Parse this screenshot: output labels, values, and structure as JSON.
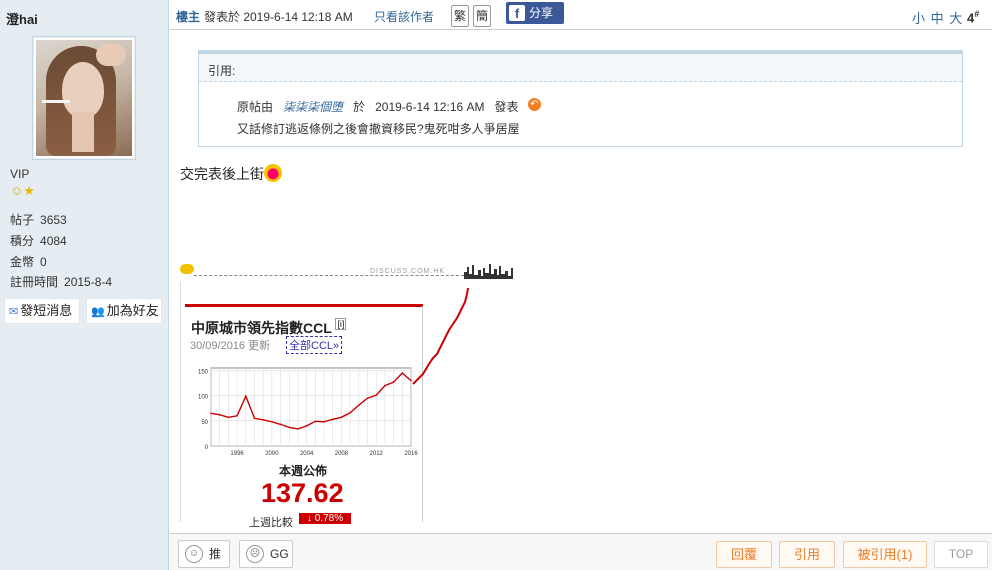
{
  "author": {
    "username": "澄hai",
    "group": "VIP",
    "stats": [
      {
        "label": "帖子",
        "value": "3653"
      },
      {
        "label": "積分",
        "value": "4084"
      },
      {
        "label": "金幣",
        "value": "0"
      },
      {
        "label": "註冊時間",
        "value": "2015-8-4"
      }
    ],
    "send_message": "發短消息",
    "add_friend": "加為好友"
  },
  "header": {
    "owner_label": "樓主",
    "posted_at": "發表於 2019-6-14 12:18 AM",
    "only_author": "只看該作者",
    "trad_btn": "繁",
    "simp_btn": "簡",
    "share_label": "分享",
    "font_sizes": "小 中 大",
    "floor_number": "4",
    "floor_suffix": "#"
  },
  "quote": {
    "header": "引用:",
    "prefix": "原帖由",
    "quoted_author": "柒柒柒個堕",
    "at_word": "於",
    "quoted_time": "2019-6-14  12:16  AM",
    "posted_word": "發表",
    "quoted_text": "又話修訂逃返條例之後會撤資移民?鬼死咁多人爭居屋"
  },
  "post": {
    "text": "交完表後上街"
  },
  "signature": {
    "watermark": "DISCUSS.COM.HK",
    "card": {
      "title": "中原城市領先指數CCL",
      "info_badge": "[i]",
      "updated": "30/09/2016 更新",
      "link": "全部CCL»",
      "weekly_label": "本週公佈",
      "value": "137.62",
      "last_week_label": "上週比較",
      "change": "↓ 0.78%"
    }
  },
  "chart_data": {
    "type": "line",
    "x": [
      1993,
      1994,
      1995,
      1996,
      1997,
      1998,
      1999,
      2000,
      2001,
      2002,
      2003,
      2004,
      2005,
      2006,
      2007,
      2008,
      2009,
      2010,
      2011,
      2012,
      2013,
      2014,
      2015,
      2016
    ],
    "y": [
      65,
      62,
      57,
      60,
      99,
      55,
      52,
      48,
      43,
      37,
      34,
      40,
      49,
      48,
      53,
      57,
      66,
      81,
      95,
      101,
      120,
      127,
      145,
      130
    ],
    "xticks": [
      "1996",
      "2000",
      "2004",
      "2008",
      "2012",
      "2016"
    ],
    "yticks": [
      "0",
      "50",
      "100",
      "150"
    ],
    "ylim": [
      0,
      155
    ],
    "series_color": "#cc0000",
    "grid": true
  },
  "actions": {
    "recommend": "推",
    "gg": "GG",
    "reply": "回覆",
    "quote": "引用",
    "quoted_by": "被引用(1)",
    "top": "TOP"
  }
}
